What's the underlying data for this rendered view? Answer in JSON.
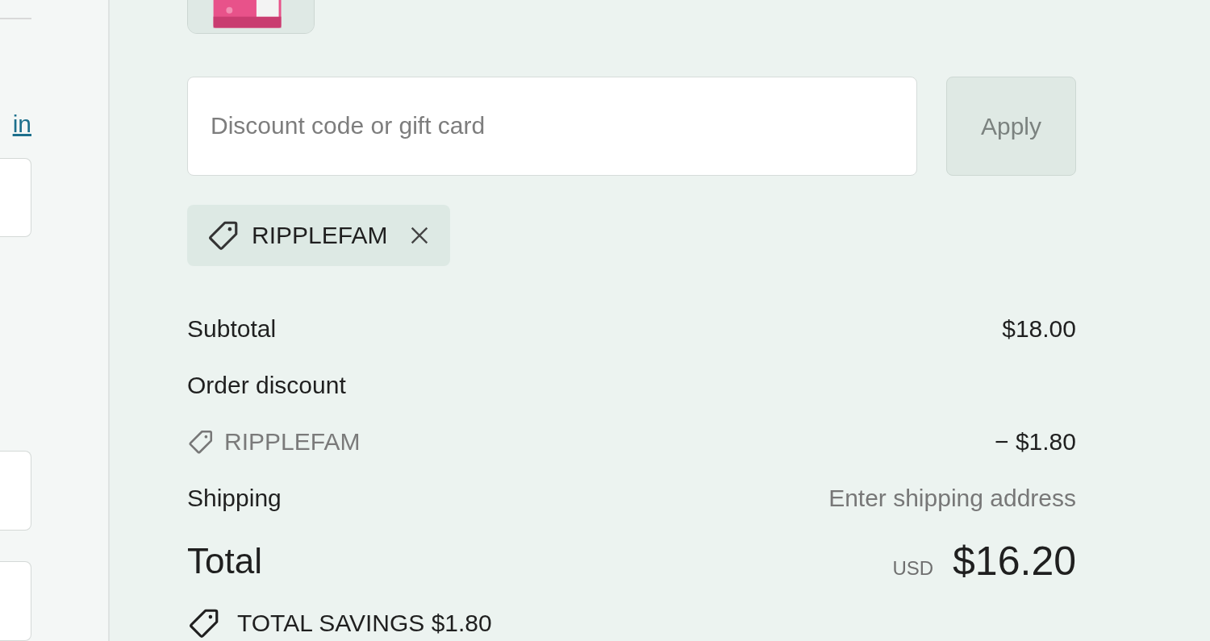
{
  "left_column": {
    "link": "in",
    "fields": [
      {
        "kind": "input"
      },
      {
        "kind": "input"
      },
      {
        "kind": "input"
      }
    ]
  },
  "discount": {
    "placeholder": "Discount code or gift card",
    "button": "Apply",
    "button_disabled": true
  },
  "applied_codes": [
    {
      "code": "RIPPLEFAM"
    }
  ],
  "summary": {
    "rows": [
      {
        "kind": "line",
        "label": "Subtotal",
        "value": "$18.00"
      },
      {
        "kind": "heading",
        "label": "Order discount"
      },
      {
        "kind": "code",
        "label": "RIPPLEFAM",
        "value": "− $1.80"
      },
      {
        "kind": "muted",
        "label": "Shipping",
        "value": "Enter shipping address"
      }
    ],
    "total": {
      "label": "Total",
      "currency": "USD",
      "value": "$16.20"
    },
    "savings": {
      "label": "TOTAL SAVINGS",
      "value": "$1.80"
    }
  }
}
